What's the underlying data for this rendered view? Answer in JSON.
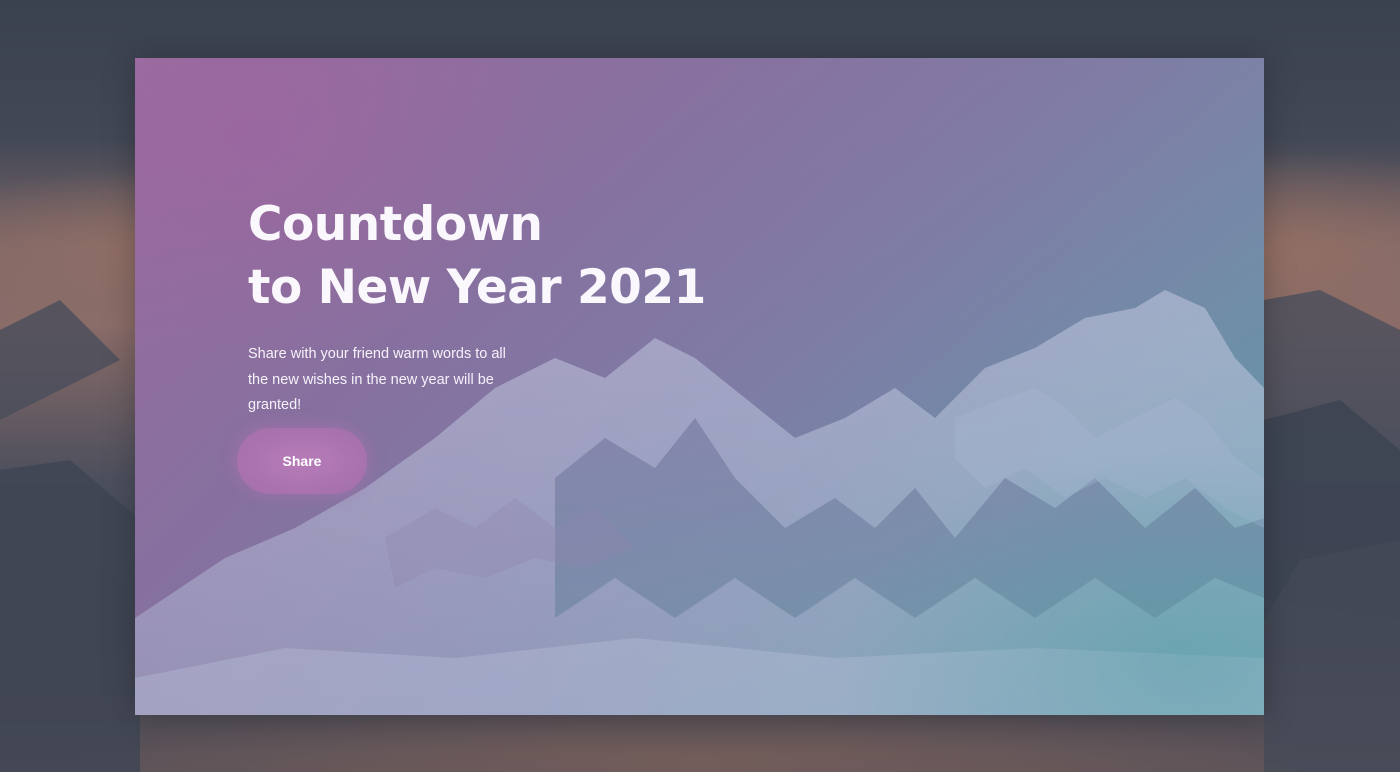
{
  "hero": {
    "title_line1": "Countdown",
    "title_line2": "to New Year 2021",
    "subtitle": "Share with your friend warm words to all the new wishes in the new year will be granted!",
    "share_label": "Share"
  },
  "theme": {
    "gradient_start": "#9a6b9e",
    "gradient_end": "#5a97a6",
    "button_color": "#b67cb8",
    "text_color": "#ffffff"
  }
}
